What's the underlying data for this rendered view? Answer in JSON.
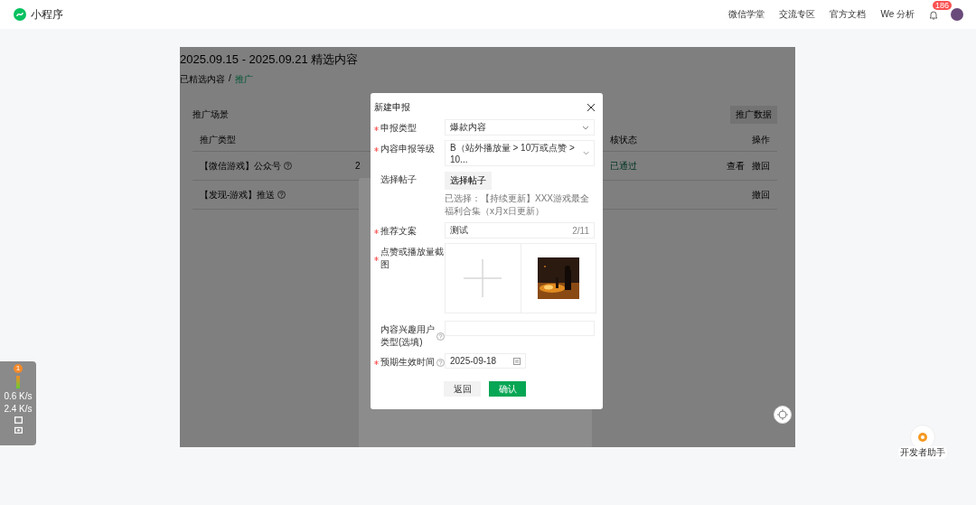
{
  "topbar": {
    "logo": "小程序",
    "nav": [
      "微信学堂",
      "交流专区",
      "官方文档",
      "We 分析"
    ],
    "notification_count": "186"
  },
  "page": {
    "title": "2025.09.15 - 2025.09.21 精选内容",
    "breadcrumb_separator": "/",
    "breadcrumb": [
      {
        "label": "已精选内容",
        "selected": false
      },
      {
        "label": "推广",
        "selected": true
      }
    ],
    "card": {
      "title": "推广场景",
      "button": "推广数据",
      "columns": [
        "推广类型",
        "核状态",
        "操作"
      ],
      "rows": [
        {
          "type": "【微信游戏】公众号",
          "column_2": "2",
          "status": "已通过",
          "actions": [
            "查看",
            "撤回"
          ]
        },
        {
          "type": "【发现-游戏】推送",
          "actions": [
            "撤回"
          ]
        }
      ]
    }
  },
  "dialog": {
    "title": "新建申报",
    "fields": [
      {
        "kind": "select",
        "label": "申报类型",
        "required": true,
        "help": false,
        "value": "爆款内容"
      },
      {
        "kind": "select",
        "label": "内容申报等级",
        "required": true,
        "help": false,
        "value": "B（站外播放量 > 10万或点赞 > 10..."
      },
      {
        "kind": "picker",
        "label": "选择帖子",
        "required": false,
        "help": false,
        "button": "选择帖子",
        "hint": "已选择：【持续更新】XXX游戏最全福利合集（x月x日更新）"
      },
      {
        "kind": "text",
        "label": "推荐文案",
        "required": true,
        "help": false,
        "value": "测试",
        "counter": "2/11"
      },
      {
        "kind": "upload",
        "label": "点赞或播放量截图",
        "required": true,
        "help": false
      },
      {
        "kind": "text",
        "label": "内容兴趣用户类型(选填)",
        "required": false,
        "help": true
      },
      {
        "kind": "date",
        "label": "预期生效时间",
        "required": true,
        "help": true,
        "value": "2025-09-18"
      }
    ],
    "buttons": [
      {
        "label": "返回",
        "primary": false
      },
      {
        "label": "确认",
        "primary": true
      }
    ]
  },
  "monitor": {
    "badge": "1",
    "readings": [
      "0.6 K/s",
      "2.4 K/s"
    ]
  },
  "assistant": {
    "label": "开发者助手"
  }
}
